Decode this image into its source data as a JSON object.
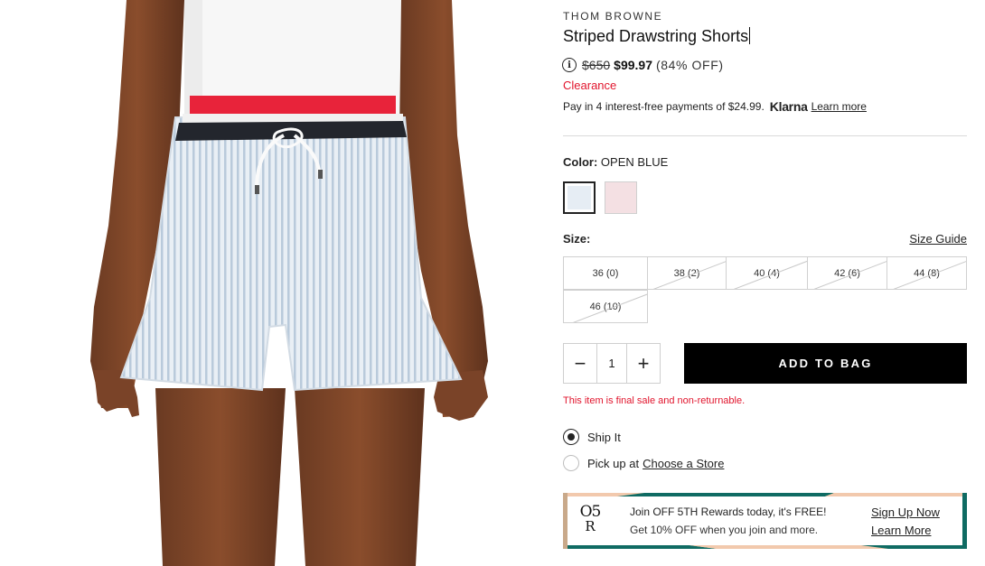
{
  "product": {
    "brand": "THOM BROWNE",
    "title": "Striped Drawstring Shorts",
    "price_original": "$650",
    "price_sale": "$99.97",
    "price_discount": "(84% OFF)",
    "clearance": "Clearance",
    "info_icon": "info-icon"
  },
  "klarna": {
    "text": "Pay in 4 interest-free payments of $24.99.",
    "logo": "Klarna",
    "learn_more": "Learn more"
  },
  "color": {
    "label": "Color:",
    "selected": "OPEN BLUE",
    "swatches": [
      {
        "name": "open-blue",
        "hex": "#e6edf4",
        "selected": true
      },
      {
        "name": "pink",
        "hex": "#f4e0e3",
        "selected": false
      }
    ]
  },
  "size": {
    "label": "Size:",
    "guide": "Size Guide",
    "options": [
      {
        "label": "36 (0)",
        "available": true
      },
      {
        "label": "38 (2)",
        "available": false
      },
      {
        "label": "40 (4)",
        "available": false
      },
      {
        "label": "42 (6)",
        "available": false
      },
      {
        "label": "44 (8)",
        "available": false
      },
      {
        "label": "46 (10)",
        "available": false
      }
    ]
  },
  "quantity": {
    "value": "1",
    "minus": "−",
    "plus": "+"
  },
  "cart": {
    "add_label": "ADD TO BAG",
    "final_sale": "This item is final sale and non-returnable."
  },
  "fulfillment": {
    "ship_label": "Ship It",
    "pickup_prefix": "Pick up at",
    "pickup_link": "Choose a Store",
    "selected": "ship"
  },
  "promo": {
    "logo_top": "O5",
    "logo_bottom": "R",
    "headline": "Join OFF 5TH Rewards today, it's FREE!",
    "subline": "Get 10% OFF when you join and more.",
    "signup": "Sign Up Now",
    "learn": "Learn More"
  },
  "colors": {
    "accent_red": "#e1142c",
    "button_black": "#000000",
    "promo_teal": "#0f6b63",
    "promo_peach": "#f2c9ad",
    "promo_cream": "#f6ecd0"
  }
}
